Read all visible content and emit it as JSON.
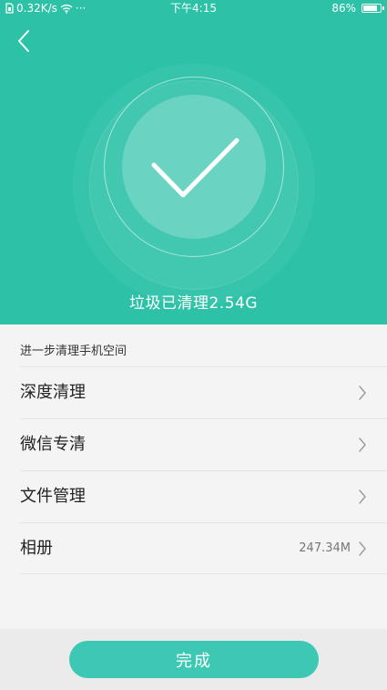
{
  "status_bar": {
    "network_speed": "0.32K/s",
    "more": "···",
    "time": "下午4:15",
    "battery": "86%",
    "battery_level": 0.86
  },
  "result": {
    "cleaned_text": "垃圾已清理2.54G"
  },
  "section": {
    "title": "进一步清理手机空间"
  },
  "items": [
    {
      "label": "深度清理",
      "value": ""
    },
    {
      "label": "微信专清",
      "value": ""
    },
    {
      "label": "文件管理",
      "value": ""
    },
    {
      "label": "相册",
      "value": "247.34M"
    }
  ],
  "footer": {
    "done_label": "完成"
  },
  "colors": {
    "header_bg": "#2dc1a8",
    "accent": "#3cc8b2",
    "page_bg": "#f4f4f4"
  }
}
